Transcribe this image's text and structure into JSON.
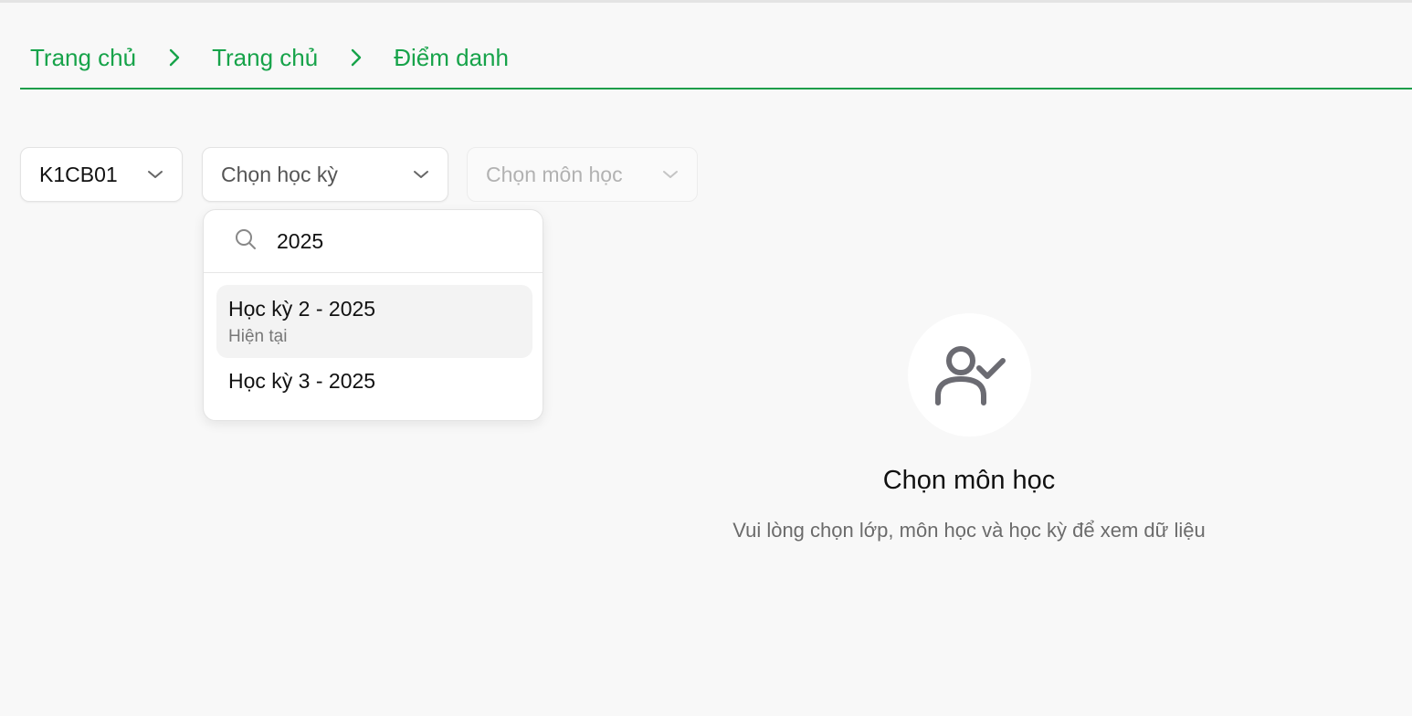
{
  "breadcrumb": {
    "items": [
      "Trang chủ",
      "Trang chủ",
      "Điểm danh"
    ]
  },
  "filters": {
    "class_value": "K1CB01",
    "term_placeholder": "Chọn học kỳ",
    "subject_placeholder": "Chọn môn học"
  },
  "term_dropdown": {
    "search_value": "2025",
    "options": [
      {
        "label": "Học kỳ 2 - 2025",
        "sublabel": "Hiện tại"
      },
      {
        "label": "Học kỳ 3 - 2025"
      }
    ]
  },
  "empty_state": {
    "icon": "user-check-icon",
    "title": "Chọn môn học",
    "description": "Vui lòng chọn lớp, môn học và học kỳ để xem dữ liệu"
  },
  "colors": {
    "accent": "#17a34a",
    "background": "#f8f8f8"
  }
}
